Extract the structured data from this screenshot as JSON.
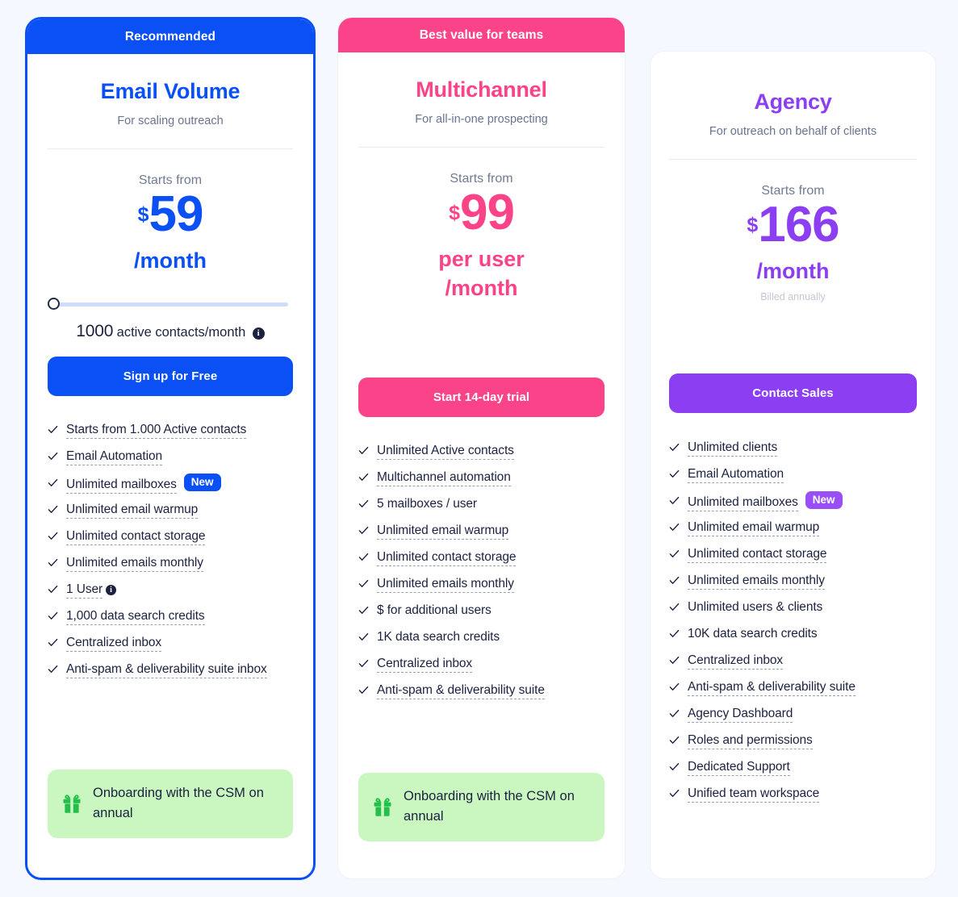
{
  "colors": {
    "page_bg": "#f5f8fe",
    "blue": "#0b50f4",
    "pink": "#fa4388",
    "purple": "#8b3ef2",
    "badge_purple": "#9a4ef5",
    "gift_bg": "#c9f7bf",
    "gift_icon": "#22bf4a",
    "text_dark": "#1c2140",
    "text_muted": "#6b7390",
    "slider_track": "#cfdcfb"
  },
  "plans": [
    {
      "ribbon": "Recommended",
      "name": "Email Volume",
      "subtitle": "For scaling outreach",
      "starts_from": "Starts from",
      "currency": "$",
      "amount": "59",
      "period": "/month",
      "billed_note": "",
      "slider": {
        "quantity": "1000",
        "unit": "active contacts/month",
        "info_icon": "info-icon",
        "value_percent": 0
      },
      "cta": "Sign up for Free",
      "features": [
        {
          "label": "Starts from 1.000 Active contacts",
          "dashed": true,
          "badge": "",
          "info": false
        },
        {
          "label": "Email Automation",
          "dashed": true,
          "badge": "",
          "info": false
        },
        {
          "label": "Unlimited mailboxes",
          "dashed": true,
          "badge": "New",
          "info": false
        },
        {
          "label": "Unlimited email warmup",
          "dashed": true,
          "badge": "",
          "info": false
        },
        {
          "label": "Unlimited contact storage",
          "dashed": true,
          "badge": "",
          "info": false
        },
        {
          "label": "Unlimited emails monthly",
          "dashed": true,
          "badge": "",
          "info": false
        },
        {
          "label": "1 User",
          "dashed": true,
          "badge": "",
          "info": true
        },
        {
          "label": "1,000 data search credits",
          "dashed": true,
          "badge": "",
          "info": false
        },
        {
          "label": "Centralized inbox",
          "dashed": true,
          "badge": "",
          "info": false
        },
        {
          "label": "Anti-spam & deliverability suite inbox",
          "dashed": true,
          "badge": "",
          "info": false
        }
      ],
      "gift": "Onboarding with the CSM on annual"
    },
    {
      "ribbon": "Best value for teams",
      "name": "Multichannel",
      "subtitle": "For all-in-one prospecting",
      "starts_from": "Starts from",
      "currency": "$",
      "amount": "99",
      "period": "per user\n/month",
      "billed_note": "",
      "cta": "Start 14-day trial",
      "features": [
        {
          "label": "Unlimited Active contacts",
          "dashed": true,
          "badge": "",
          "info": false
        },
        {
          "label": "Multichannel automation",
          "dashed": true,
          "badge": "",
          "info": false
        },
        {
          "label": "5 mailboxes / user",
          "dashed": false,
          "badge": "",
          "info": false
        },
        {
          "label": "Unlimited email warmup",
          "dashed": true,
          "badge": "",
          "info": false
        },
        {
          "label": "Unlimited contact storage",
          "dashed": true,
          "badge": "",
          "info": false
        },
        {
          "label": "Unlimited emails monthly",
          "dashed": true,
          "badge": "",
          "info": false
        },
        {
          "label": "$ for additional users",
          "dashed": false,
          "badge": "",
          "info": false
        },
        {
          "label": "1K data search credits",
          "dashed": false,
          "badge": "",
          "info": false
        },
        {
          "label": "Centralized inbox",
          "dashed": true,
          "badge": "",
          "info": false
        },
        {
          "label": "Anti-spam & deliverability suite",
          "dashed": true,
          "badge": "",
          "info": false
        }
      ],
      "gift": "Onboarding with the CSM on annual"
    },
    {
      "ribbon": "",
      "name": "Agency",
      "subtitle": "For outreach on behalf of clients",
      "starts_from": "Starts from",
      "currency": "$",
      "amount": "166",
      "period": "/month",
      "billed_note": "Billed annually",
      "cta": "Contact Sales",
      "features": [
        {
          "label": "Unlimited clients",
          "dashed": true,
          "badge": "",
          "info": false
        },
        {
          "label": "Email Automation",
          "dashed": true,
          "badge": "",
          "info": false
        },
        {
          "label": "Unlimited mailboxes",
          "dashed": true,
          "badge": "New",
          "info": false
        },
        {
          "label": "Unlimited email warmup",
          "dashed": true,
          "badge": "",
          "info": false
        },
        {
          "label": "Unlimited contact storage",
          "dashed": true,
          "badge": "",
          "info": false
        },
        {
          "label": "Unlimited emails monthly",
          "dashed": true,
          "badge": "",
          "info": false
        },
        {
          "label": "Unlimited users & clients",
          "dashed": false,
          "badge": "",
          "info": false
        },
        {
          "label": "10K data search credits",
          "dashed": false,
          "badge": "",
          "info": false
        },
        {
          "label": "Centralized inbox",
          "dashed": true,
          "badge": "",
          "info": false
        },
        {
          "label": "Anti-spam & deliverability suite",
          "dashed": true,
          "badge": "",
          "info": false
        },
        {
          "label": "Agency Dashboard",
          "dashed": true,
          "badge": "",
          "info": false
        },
        {
          "label": "Roles and permissions",
          "dashed": true,
          "badge": "",
          "info": false
        },
        {
          "label": "Dedicated Support",
          "dashed": true,
          "badge": "",
          "info": false
        },
        {
          "label": "Unified team workspace",
          "dashed": true,
          "badge": "",
          "info": false
        }
      ],
      "gift": ""
    }
  ]
}
